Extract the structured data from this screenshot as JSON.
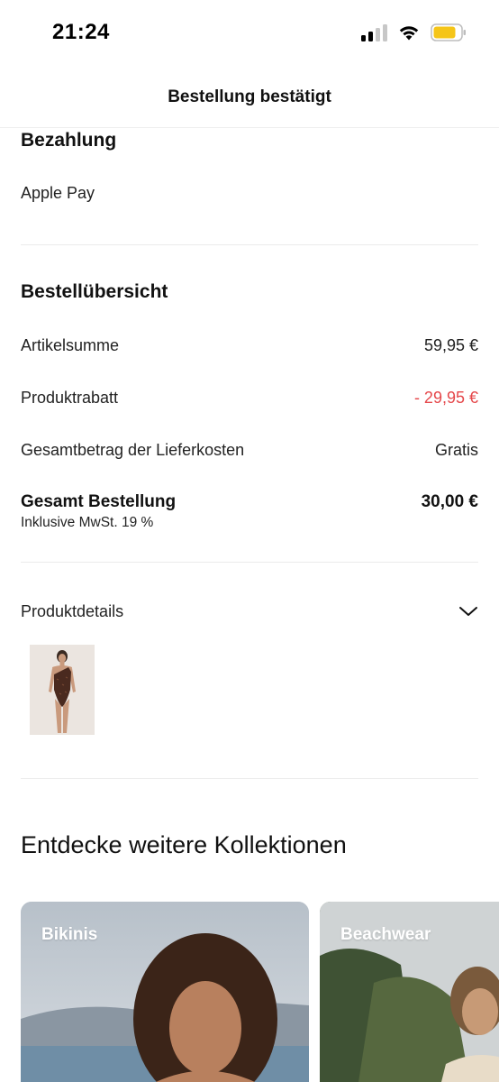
{
  "status_bar": {
    "time": "21:24",
    "icons": [
      "signal-icon",
      "wifi-icon",
      "battery-icon"
    ],
    "battery_color": "#f5c518"
  },
  "nav": {
    "title": "Bestellung bestätigt"
  },
  "payment": {
    "heading": "Bezahlung",
    "method": "Apple Pay"
  },
  "summary": {
    "heading": "Bestellübersicht",
    "rows": [
      {
        "label": "Artikelsumme",
        "value": "59,95 €"
      },
      {
        "label": "Produktrabatt",
        "value": "- 29,95 €"
      },
      {
        "label": "Gesamtbetrag der Lieferkosten",
        "value": "Gratis"
      }
    ],
    "total": {
      "label": "Gesamt Bestellung",
      "value": "30,00 €",
      "tax_note": "Inklusive MwSt. 19 %"
    },
    "discount_color": "#e5474a"
  },
  "product_details": {
    "label": "Produktdetails",
    "toggle_icon": "chevron-down-icon"
  },
  "collections": {
    "heading": "Entdecke weitere Kollektionen",
    "cards": [
      {
        "label": "Bikinis"
      },
      {
        "label": "Beachwear"
      }
    ]
  }
}
